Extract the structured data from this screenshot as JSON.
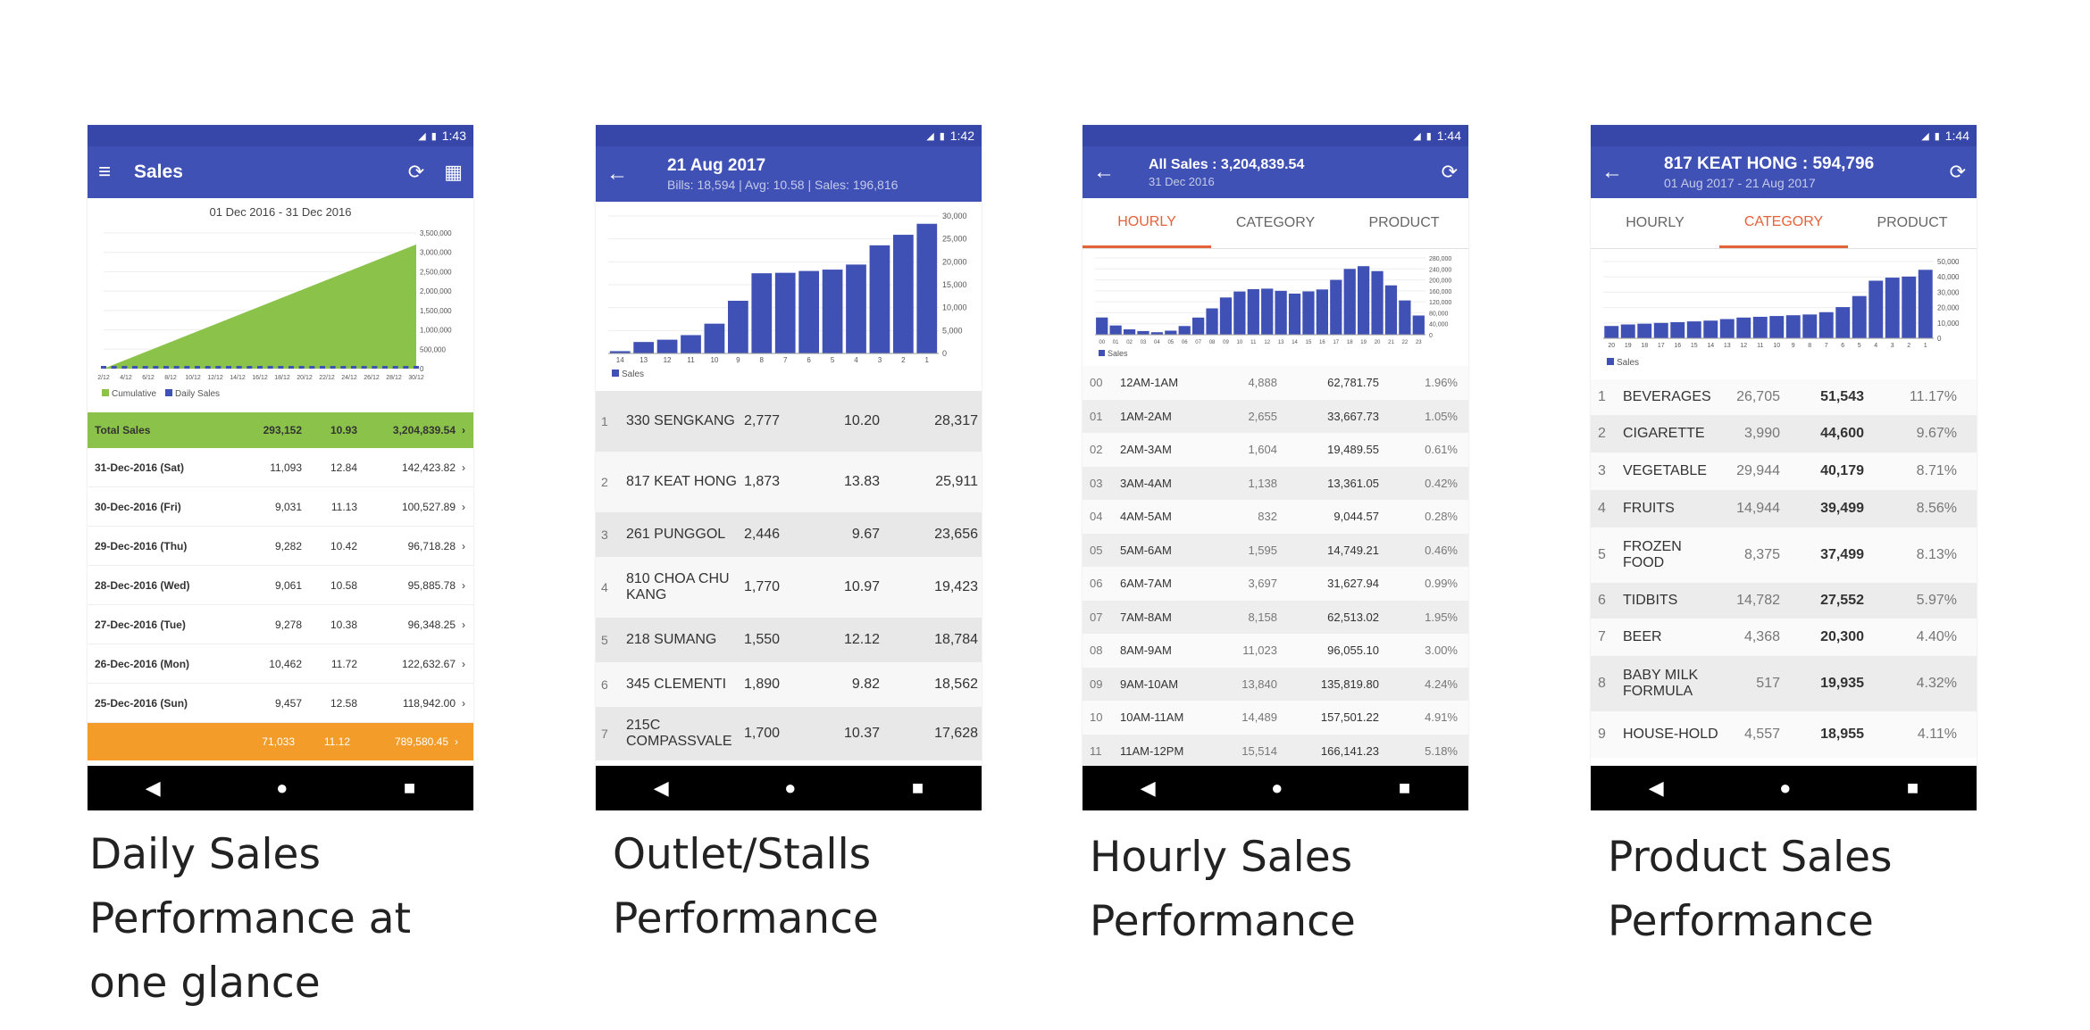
{
  "captions": {
    "daily": [
      "Daily Sales",
      "Performance at",
      "one glance"
    ],
    "outlet": [
      "Outlet/Stalls",
      "Performance"
    ],
    "hourly": [
      "Hourly Sales",
      "Performance"
    ],
    "product": [
      "Product Sales",
      "Performance"
    ]
  },
  "colors": {
    "appbar": "#3f51b5",
    "bar": "#3f51b5",
    "area": "#8bc34a",
    "total_row": "#8bc34a",
    "footer_row": "#f39c2a",
    "accent": "#e5613a"
  },
  "phone1": {
    "time": "1:43",
    "title": "Sales",
    "date_range": "01 Dec 2016 - 31 Dec 2016",
    "legend": [
      "Cumulative",
      "Daily Sales"
    ],
    "chart_data": {
      "type": "area",
      "y_ticks": [
        "3,500,000",
        "3,000,000",
        "2,500,000",
        "2,000,000",
        "1,500,000",
        "1,000,000",
        "500,000",
        "0"
      ],
      "x_ticks": [
        "2/12",
        "4/12",
        "6/12",
        "8/12",
        "10/12",
        "12/12",
        "14/12",
        "16/12",
        "18/12",
        "20/12",
        "22/12",
        "24/12",
        "26/12",
        "28/12",
        "30/12"
      ],
      "ylim": [
        0,
        3500000
      ],
      "x": [
        1,
        31
      ],
      "cumulative": [
        0,
        3204839.54
      ]
    },
    "total": {
      "label": "Total Sales",
      "bills": "293,152",
      "avg": "10.93",
      "sales": "3,204,839.54"
    },
    "rows": [
      {
        "label": "31-Dec-2016 (Sat)",
        "bills": "11,093",
        "avg": "12.84",
        "sales": "142,423.82"
      },
      {
        "label": "30-Dec-2016 (Fri)",
        "bills": "9,031",
        "avg": "11.13",
        "sales": "100,527.89"
      },
      {
        "label": "29-Dec-2016 (Thu)",
        "bills": "9,282",
        "avg": "10.42",
        "sales": "96,718.28"
      },
      {
        "label": "28-Dec-2016 (Wed)",
        "bills": "9,061",
        "avg": "10.58",
        "sales": "95,885.78"
      },
      {
        "label": "27-Dec-2016 (Tue)",
        "bills": "9,278",
        "avg": "10.38",
        "sales": "96,348.25"
      },
      {
        "label": "26-Dec-2016 (Mon)",
        "bills": "10,462",
        "avg": "11.72",
        "sales": "122,632.67"
      },
      {
        "label": "25-Dec-2016 (Sun)",
        "bills": "9,457",
        "avg": "12.58",
        "sales": "118,942.00"
      }
    ],
    "footer": {
      "bills": "71,033",
      "avg": "11.12",
      "sales": "789,580.45"
    }
  },
  "phone2": {
    "time": "1:42",
    "title": "21 Aug 2017",
    "subtitle": "Bills: 18,594 | Avg: 10.58 | Sales: 196,816",
    "legend": "Sales",
    "chart_data": {
      "type": "bar",
      "categories": [
        "14",
        "13",
        "12",
        "11",
        "10",
        "9",
        "8",
        "7",
        "6",
        "5",
        "4",
        "3",
        "2",
        "1"
      ],
      "values": [
        500,
        2500,
        3000,
        4000,
        6500,
        11500,
        17500,
        17600,
        18000,
        18300,
        19400,
        23600,
        25900,
        28300
      ],
      "y_ticks": [
        "30,000",
        "25,000",
        "20,000",
        "15,000",
        "10,000",
        "5,000",
        "0"
      ],
      "ylim": [
        0,
        30000
      ]
    },
    "rows": [
      {
        "rank": "1",
        "name": "330 SENGKANG",
        "bills": "2,777",
        "avg": "10.20",
        "sales": "28,317"
      },
      {
        "rank": "2",
        "name": "817 KEAT HONG",
        "bills": "1,873",
        "avg": "13.83",
        "sales": "25,911"
      },
      {
        "rank": "3",
        "name": "261 PUNGGOL",
        "bills": "2,446",
        "avg": "9.67",
        "sales": "23,656"
      },
      {
        "rank": "4",
        "name": "810 CHOA CHU KANG",
        "bills": "1,770",
        "avg": "10.97",
        "sales": "19,423"
      },
      {
        "rank": "5",
        "name": "218 SUMANG",
        "bills": "1,550",
        "avg": "12.12",
        "sales": "18,784"
      },
      {
        "rank": "6",
        "name": "345 CLEMENTI",
        "bills": "1,890",
        "avg": "9.82",
        "sales": "18,562"
      },
      {
        "rank": "7",
        "name": "215C COMPASSVALE",
        "bills": "1,700",
        "avg": "10.37",
        "sales": "17,628"
      }
    ]
  },
  "phone3": {
    "time": "1:44",
    "title": "All Sales : 3,204,839.54",
    "subtitle": "31 Dec 2016",
    "tabs": [
      "HOURLY",
      "CATEGORY",
      "PRODUCT"
    ],
    "active_tab": 0,
    "legend": "Sales",
    "chart_data": {
      "type": "bar",
      "categories": [
        "00",
        "01",
        "02",
        "03",
        "04",
        "05",
        "06",
        "07",
        "08",
        "09",
        "10",
        "11",
        "12",
        "13",
        "14",
        "15",
        "16",
        "17",
        "18",
        "19",
        "20",
        "21",
        "22",
        "23"
      ],
      "values": [
        62782,
        33668,
        19490,
        13361,
        9045,
        14749,
        31628,
        62513,
        96055,
        135820,
        157501,
        166141,
        168000,
        160000,
        150000,
        158000,
        165000,
        200000,
        240000,
        250000,
        232000,
        180000,
        125000,
        70000
      ],
      "y_ticks": [
        "280,000",
        "240,000",
        "200,000",
        "160,000",
        "120,000",
        "80,000",
        "40,000",
        "0"
      ],
      "ylim": [
        0,
        280000
      ]
    },
    "rows": [
      {
        "hr": "00",
        "label": "12AM-1AM",
        "bills": "4,888",
        "sales": "62,781.75",
        "pct": "1.96%"
      },
      {
        "hr": "01",
        "label": "1AM-2AM",
        "bills": "2,655",
        "sales": "33,667.73",
        "pct": "1.05%"
      },
      {
        "hr": "02",
        "label": "2AM-3AM",
        "bills": "1,604",
        "sales": "19,489.55",
        "pct": "0.61%"
      },
      {
        "hr": "03",
        "label": "3AM-4AM",
        "bills": "1,138",
        "sales": "13,361.05",
        "pct": "0.42%"
      },
      {
        "hr": "04",
        "label": "4AM-5AM",
        "bills": "832",
        "sales": "9,044.57",
        "pct": "0.28%"
      },
      {
        "hr": "05",
        "label": "5AM-6AM",
        "bills": "1,595",
        "sales": "14,749.21",
        "pct": "0.46%"
      },
      {
        "hr": "06",
        "label": "6AM-7AM",
        "bills": "3,697",
        "sales": "31,627.94",
        "pct": "0.99%"
      },
      {
        "hr": "07",
        "label": "7AM-8AM",
        "bills": "8,158",
        "sales": "62,513.02",
        "pct": "1.95%"
      },
      {
        "hr": "08",
        "label": "8AM-9AM",
        "bills": "11,023",
        "sales": "96,055.10",
        "pct": "3.00%"
      },
      {
        "hr": "09",
        "label": "9AM-10AM",
        "bills": "13,840",
        "sales": "135,819.80",
        "pct": "4.24%"
      },
      {
        "hr": "10",
        "label": "10AM-11AM",
        "bills": "14,489",
        "sales": "157,501.22",
        "pct": "4.91%"
      },
      {
        "hr": "11",
        "label": "11AM-12PM",
        "bills": "15,514",
        "sales": "166,141.23",
        "pct": "5.18%"
      }
    ]
  },
  "phone4": {
    "time": "1:44",
    "title": "817 KEAT HONG : 594,796",
    "subtitle": "01 Aug 2017 - 21 Aug 2017",
    "tabs": [
      "HOURLY",
      "CATEGORY",
      "PRODUCT"
    ],
    "active_tab": 1,
    "legend": "Sales",
    "chart_data": {
      "type": "bar",
      "categories": [
        "20",
        "19",
        "18",
        "17",
        "16",
        "15",
        "14",
        "13",
        "12",
        "11",
        "10",
        "9",
        "8",
        "7",
        "6",
        "5",
        "4",
        "3",
        "2",
        "1"
      ],
      "values": [
        8000,
        9000,
        9500,
        10000,
        10500,
        11000,
        11500,
        12500,
        13500,
        14000,
        14500,
        15000,
        15500,
        17000,
        20300,
        27500,
        37500,
        39500,
        40200,
        44600
      ],
      "y_ticks": [
        "50,000",
        "40,000",
        "30,000",
        "20,000",
        "10,000",
        "0"
      ],
      "ylim": [
        0,
        50000
      ]
    },
    "rows": [
      {
        "rank": "1",
        "name": "BEVERAGES",
        "qty": "26,705",
        "sales": "51,543",
        "pct": "11.17%"
      },
      {
        "rank": "2",
        "name": "CIGARETTE",
        "qty": "3,990",
        "sales": "44,600",
        "pct": "9.67%"
      },
      {
        "rank": "3",
        "name": "VEGETABLE",
        "qty": "29,944",
        "sales": "40,179",
        "pct": "8.71%"
      },
      {
        "rank": "4",
        "name": "FRUITS",
        "qty": "14,944",
        "sales": "39,499",
        "pct": "8.56%"
      },
      {
        "rank": "5",
        "name": "FROZEN FOOD",
        "qty": "8,375",
        "sales": "37,499",
        "pct": "8.13%"
      },
      {
        "rank": "6",
        "name": "TIDBITS",
        "qty": "14,782",
        "sales": "27,552",
        "pct": "5.97%"
      },
      {
        "rank": "7",
        "name": "BEER",
        "qty": "4,368",
        "sales": "20,300",
        "pct": "4.40%"
      },
      {
        "rank": "8",
        "name": "BABY MILK FORMULA",
        "qty": "517",
        "sales": "19,935",
        "pct": "4.32%"
      },
      {
        "rank": "9",
        "name": "HOUSE-HOLD",
        "qty": "4,557",
        "sales": "18,955",
        "pct": "4.11%"
      }
    ]
  },
  "nav_icons": [
    "back-icon",
    "home-icon",
    "recents-icon"
  ]
}
